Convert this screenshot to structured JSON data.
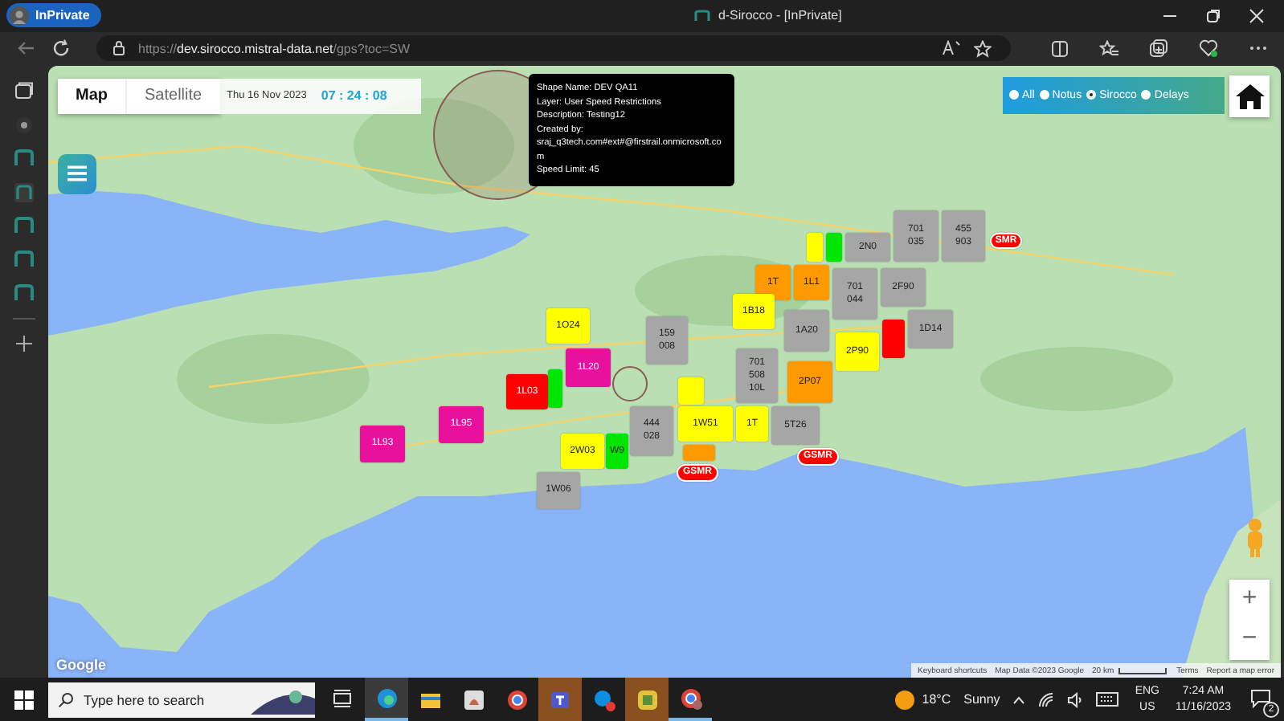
{
  "browser": {
    "inprivate_label": "InPrivate",
    "tab_title": "d-Sirocco - [InPrivate]",
    "url_scheme": "https://",
    "url_host": "dev.sirocco.mistral-data.net",
    "url_path": "/gps?toc=SW"
  },
  "map": {
    "type_buttons": [
      {
        "label": "Map",
        "selected": true
      },
      {
        "label": "Satellite",
        "selected": false
      }
    ],
    "date": "Thu 16 Nov 2023",
    "time": "07 : 24 : 08",
    "tooltip": {
      "lines": [
        "Shape Name: DEV QA11",
        "Layer: User Speed Restrictions",
        "Description: Testing12",
        "Created by:",
        "sraj_q3tech.com#ext#@firstrail.onmicrosoft.com",
        "Speed Limit: 45"
      ]
    },
    "filters": [
      {
        "label": "All",
        "selected": false
      },
      {
        "label": "Notus",
        "selected": false
      },
      {
        "label": "Sirocco",
        "selected": true
      },
      {
        "label": "Delays",
        "selected": false
      }
    ],
    "markers": [
      {
        "kind": "pin",
        "color": "#a6a6a6",
        "lines": [
          "701",
          "035"
        ]
      },
      {
        "kind": "pin",
        "color": "#a6a6a6",
        "lines": [
          "455",
          "903"
        ]
      },
      {
        "kind": "pin",
        "color": "#ffff00"
      },
      {
        "kind": "pin",
        "color": "#00e600"
      },
      {
        "kind": "pin",
        "color": "#a6a6a6",
        "lines": [
          "2N0"
        ]
      },
      {
        "kind": "pill",
        "color": "#ff0000",
        "lines": [
          "SMR"
        ]
      },
      {
        "kind": "pin",
        "color": "#ff9900",
        "lines": [
          "1T"
        ]
      },
      {
        "kind": "pin",
        "color": "#ff9900",
        "lines": [
          "1L1"
        ]
      },
      {
        "kind": "pin",
        "color": "#a6a6a6",
        "lines": [
          "701",
          "044"
        ]
      },
      {
        "kind": "pin",
        "color": "#a6a6a6",
        "lines": [
          "2F90"
        ]
      },
      {
        "kind": "pin",
        "color": "#ffff00",
        "lines": [
          "1B18"
        ]
      },
      {
        "kind": "pin",
        "color": "#ffff00",
        "lines": [
          "1O24"
        ]
      },
      {
        "kind": "pin",
        "color": "#a6a6a6",
        "lines": [
          "1A20"
        ]
      },
      {
        "kind": "pin",
        "color": "#a6a6a6",
        "lines": [
          "1D14"
        ]
      },
      {
        "kind": "pin",
        "color": "#a6a6a6",
        "lines": [
          "159",
          "008"
        ]
      },
      {
        "kind": "pin",
        "color": "#ff0000"
      },
      {
        "kind": "pin",
        "color": "#ffff00",
        "lines": [
          "2P90"
        ]
      },
      {
        "kind": "pin",
        "color": "#e8109c",
        "lines": [
          "1L20"
        ]
      },
      {
        "kind": "pin",
        "color": "#a6a6a6",
        "lines": [
          "701",
          "508",
          "10L"
        ]
      },
      {
        "kind": "pin",
        "color": "#ff9900",
        "lines": [
          "2P07"
        ]
      },
      {
        "kind": "pin",
        "color": "#00e600"
      },
      {
        "kind": "pin",
        "color": "#ff0000",
        "lines": [
          "1L03"
        ]
      },
      {
        "kind": "pin",
        "color": "#ffff00"
      },
      {
        "kind": "pin",
        "color": "#e8109c",
        "lines": [
          "1L95"
        ]
      },
      {
        "kind": "pin",
        "color": "#a6a6a6",
        "lines": [
          "444",
          "028"
        ]
      },
      {
        "kind": "pin",
        "color": "#ffff00",
        "lines": [
          "1W51"
        ]
      },
      {
        "kind": "pin",
        "color": "#ffff00",
        "lines": [
          "1T"
        ]
      },
      {
        "kind": "pin",
        "color": "#a6a6a6",
        "lines": [
          "5T26"
        ]
      },
      {
        "kind": "pin",
        "color": "#e8109c",
        "lines": [
          "1L93"
        ]
      },
      {
        "kind": "pin",
        "color": "#ffff00",
        "lines": [
          "2W03"
        ]
      },
      {
        "kind": "pin",
        "color": "#00e600",
        "lines": [
          "W9"
        ]
      },
      {
        "kind": "pin",
        "color": "#ff9900"
      },
      {
        "kind": "pill",
        "color": "#ff0000",
        "lines": [
          "GSMR"
        ]
      },
      {
        "kind": "pill",
        "color": "#ff0000",
        "lines": [
          "GSMR"
        ]
      },
      {
        "kind": "pin",
        "color": "#a6a6a6",
        "lines": [
          "1W06"
        ]
      }
    ],
    "zoom_buttons": [
      "+",
      "−"
    ],
    "logo": "Google",
    "attribution": [
      "Keyboard shortcuts",
      "Map Data ©2023 Google",
      "20 km",
      "Terms",
      "Report a map error"
    ]
  },
  "taskbar": {
    "search_placeholder": "Type here to search",
    "temperature": "18°C",
    "weather": "Sunny",
    "language": "ENG",
    "region": "US",
    "time": "7:24 AM",
    "date": "11/16/2023",
    "notification_count": "2"
  }
}
